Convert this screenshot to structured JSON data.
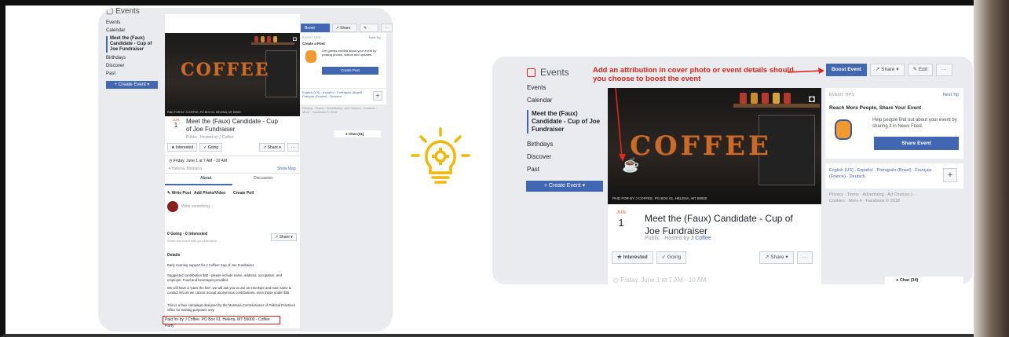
{
  "left_panel": {
    "app_title": "Events",
    "sidebar": [
      "Events",
      "Calendar",
      "Meet the (Faux) Candidate - Cup of Joe Fundraiser",
      "Birthdays",
      "Discover",
      "Past"
    ],
    "create_event": "+ Create Event ▾",
    "buttons": {
      "boost": "Boost Event",
      "share": "↗ Share ▾",
      "edit": "✎ Edit",
      "more": "···"
    },
    "event_tips": {
      "label": "EVENT TIPS",
      "next": "Next Tip",
      "title": "Create a Post",
      "body": "Get guests excited about your event by posting photos, videos and updates.",
      "button": "Create Post"
    },
    "langs": "English (US) · Español · Português (Brasil) · Français (France) · Deutsch",
    "footer": "Privacy · Terms · Advertising · Ad Choices · Cookies · More · Facebook © 2018",
    "chat": "● Chat (31)",
    "cover_caption": "PAID FOR BY J COFFEE, PO BOX 01, HELENA, MT 59000",
    "cover_word": "COFFEE",
    "date_month": "JUN",
    "date_day": "1",
    "event_title": "Meet the (Faux) Candidate - Cup of Joe Fundraiser",
    "event_sub": "Public · Hosted by J Coffee",
    "interested": "★ Interested",
    "going": "✓ Going",
    "share": "↗ Share ▾",
    "datetime": "Friday, June 1 at 7 AM - 10 AM",
    "location": "Helena, Montana",
    "show_map": "Show Map",
    "tabs": [
      "About",
      "Discussion"
    ],
    "composer": [
      "✎ Write Post",
      "Add Photo/Video",
      "Create Poll"
    ],
    "write_placeholder": "Write something...",
    "going_count": "0 Going · 0 Interested",
    "share_hint": "Share this event with your followers",
    "details_label": "Details",
    "details": [
      "Early morning support for J Coffee! Cup of Joe Fundraiser.",
      "Suggested contribution $40 - please include name, address, occupation, and employer. Food and beverages provided.",
      "We will have a \"pass the hat\"; we will ask you to use an envelope and note name & contact info as we cannot accept anonymous contributions, even those under $35.",
      "This is a faux campaign designed by the Montana Commissioner of Political Practices office for training purposes only."
    ],
    "paid_for": "Paid for by J Coffee, PO Box 01, Helena, MT 59000 - Coffee Party"
  },
  "right_panel": {
    "app_title": "Events",
    "sidebar": [
      "Events",
      "Calendar",
      "Meet the (Faux) Candidate - Cup of Joe Fundraiser",
      "Birthdays",
      "Discover",
      "Past"
    ],
    "create_event": "+ Create Event ▾",
    "annotation": "Add an attribution in cover photo or event details should you choose to boost the event",
    "buttons": {
      "boost": "Boost Event",
      "share": "↗ Share ▾",
      "edit": "✎ Edit",
      "more": "···"
    },
    "event_tips": {
      "label": "EVENT TIPS",
      "next": "Next Tip",
      "title": "Reach More People, Share Your Event",
      "body": "Help people find out about your event by sharing it in News Feed.",
      "button": "Share Event"
    },
    "langs": "English (US) · Español · Português (Brasil) · Français (France) · Deutsch",
    "footer": "Privacy · Terms · Advertising · Ad Choices ▷ · Cookies · More ▾ · Facebook © 2018",
    "chat": "● Chat (34)",
    "cover_caption": "PAID FOR BY J COFFEE, PO BOX 01, HELENA, MT 59000",
    "cover_word": "COFFEE",
    "date_month": "JUN",
    "date_day": "1",
    "event_title": "Meet the (Faux) Candidate - Cup of Joe Fundraiser",
    "event_sub_prefix": "Public · Hosted by ",
    "event_host": "J Coffee",
    "interested": "★ Interested",
    "going": "✓ Going",
    "share": "↗ Share ▾",
    "more": "···",
    "datetime": "Friday, June 1 at 7 AM - 10 AM"
  },
  "colors": {
    "accent": "#4267b2",
    "annotation": "#e0251b",
    "bulb": "#f2b705",
    "date": "#f05d3b"
  }
}
